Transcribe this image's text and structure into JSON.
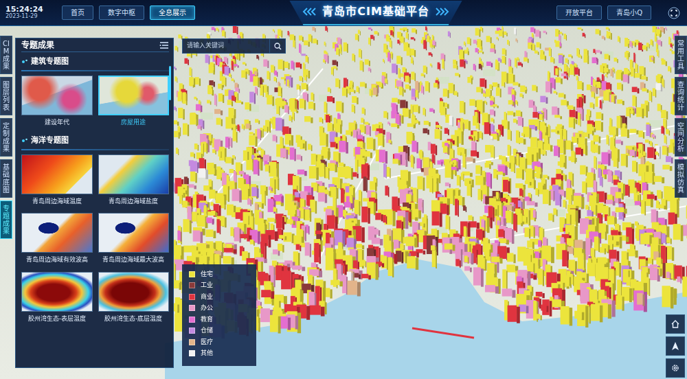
{
  "header": {
    "time": "15:24:24",
    "date": "2023-11-29",
    "title": "青岛市CIM基础平台",
    "nav_left": [
      {
        "label": "首页",
        "selected": false
      },
      {
        "label": "数字中枢",
        "selected": false
      },
      {
        "label": "全息展示",
        "selected": true
      }
    ],
    "nav_right": [
      {
        "label": "开放平台"
      },
      {
        "label": "青岛小Q"
      }
    ]
  },
  "left_tabs": [
    {
      "label": "CIM成果",
      "selected": false
    },
    {
      "label": "图层列表",
      "selected": false
    },
    {
      "label": "定制成果",
      "selected": false
    },
    {
      "label": "基础底图",
      "selected": false
    },
    {
      "label": "专题成果",
      "selected": true
    }
  ],
  "panel": {
    "title": "专题成果",
    "sections": [
      {
        "title": "建筑专题图",
        "items": [
          {
            "label": "建设年代",
            "selected": false
          },
          {
            "label": "房屋用途",
            "selected": true
          }
        ]
      },
      {
        "title": "海洋专题图",
        "items": [
          {
            "label": "青岛周边海域温度",
            "selected": false
          },
          {
            "label": "青岛周边海域盐度",
            "selected": false
          },
          {
            "label": "青岛周边海域有效波高",
            "selected": false
          },
          {
            "label": "青岛周边海域最大波高",
            "selected": false
          },
          {
            "label": "胶州湾生态-表层温度",
            "selected": false
          },
          {
            "label": "胶州湾生态-底层温度",
            "selected": false
          }
        ]
      }
    ]
  },
  "search": {
    "placeholder": "请输入关键词"
  },
  "legend": [
    {
      "label": "住宅",
      "color": "#ece43c"
    },
    {
      "label": "工业",
      "color": "#8a3a3a"
    },
    {
      "label": "商业",
      "color": "#e0343f"
    },
    {
      "label": "办公",
      "color": "#e898c8"
    },
    {
      "label": "教育",
      "color": "#e46ed0"
    },
    {
      "label": "仓储",
      "color": "#c48ae0"
    },
    {
      "label": "医疗",
      "color": "#e2b48a"
    },
    {
      "label": "其他",
      "color": "#f2f2f2"
    }
  ],
  "right_tabs": [
    {
      "label": "常用工具"
    },
    {
      "label": "查询统计"
    },
    {
      "label": "空间分析"
    },
    {
      "label": "模拟仿真"
    }
  ]
}
